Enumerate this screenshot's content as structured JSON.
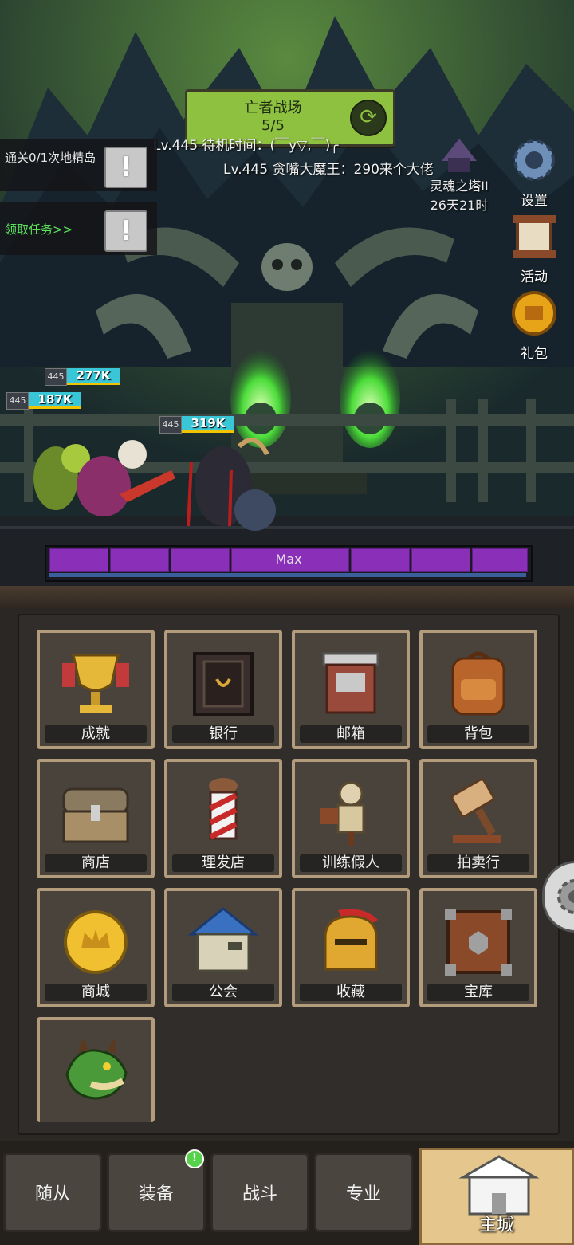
{
  "stage": {
    "name": "亡者战场",
    "progress": "5/5"
  },
  "messages": [
    "Lv.445 待机时间：(￣y▽,￣)╭",
    "Lv.445 贪嘴大魔王：290来个大佬"
  ],
  "quests": [
    {
      "text": "通关0/1次地精岛"
    },
    {
      "text": "领取任务>>"
    }
  ],
  "tower": {
    "name": "灵魂之塔II",
    "time": "26天21时"
  },
  "side_buttons": {
    "settings": "设置",
    "events": "活动",
    "gifts": "礼包"
  },
  "party": [
    {
      "level": "445",
      "hp": "277K"
    },
    {
      "level": "445",
      "hp": "187K"
    },
    {
      "level": "445",
      "hp": "319K"
    }
  ],
  "energy_bar": {
    "label": "Max",
    "fill": 1.0
  },
  "menu": [
    {
      "label": "成就",
      "icon": "trophy-icon"
    },
    {
      "label": "银行",
      "icon": "safe-icon"
    },
    {
      "label": "邮箱",
      "icon": "mailbox-icon"
    },
    {
      "label": "背包",
      "icon": "backpack-icon"
    },
    {
      "label": "商店",
      "icon": "chest-icon"
    },
    {
      "label": "理发店",
      "icon": "barber-pole-icon"
    },
    {
      "label": "训练假人",
      "icon": "training-dummy-icon"
    },
    {
      "label": "拍卖行",
      "icon": "gavel-icon"
    },
    {
      "label": "商城",
      "icon": "crown-coin-icon"
    },
    {
      "label": "公会",
      "icon": "guild-house-icon"
    },
    {
      "label": "收藏",
      "icon": "helmet-icon"
    },
    {
      "label": "宝库",
      "icon": "vault-icon"
    },
    {
      "label": "",
      "icon": "dragon-icon"
    }
  ],
  "nav": {
    "followers": "随从",
    "equipment": "装备",
    "battle": "战斗",
    "profession": "专业",
    "main_city": "主城"
  },
  "nav_badge": "!"
}
